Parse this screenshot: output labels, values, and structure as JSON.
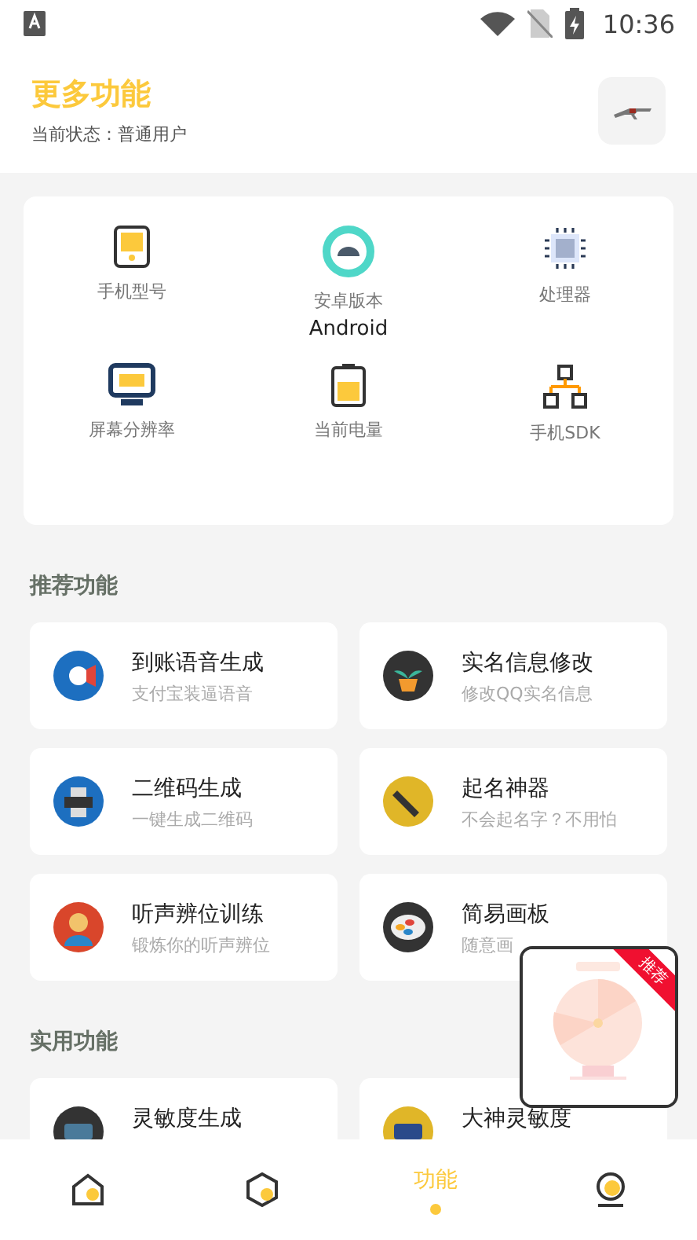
{
  "status_bar": {
    "time": "10:36"
  },
  "header": {
    "title": "更多功能",
    "subtitle": "当前状态：普通用户"
  },
  "device_info": [
    {
      "label": "手机型号"
    },
    {
      "label": "安卓版本",
      "value": "Android"
    },
    {
      "label": "处理器"
    },
    {
      "label": "屏幕分辨率"
    },
    {
      "label": "当前电量"
    },
    {
      "label": "手机SDK"
    }
  ],
  "sections": [
    {
      "title": "推荐功能",
      "cards": [
        {
          "title": "到账语音生成",
          "subtitle": "支付宝装逼语音"
        },
        {
          "title": "实名信息修改",
          "subtitle": "修改QQ实名信息"
        },
        {
          "title": "二维码生成",
          "subtitle": "一键生成二维码"
        },
        {
          "title": "起名神器",
          "subtitle": "不会起名字？不用怕"
        },
        {
          "title": "听声辨位训练",
          "subtitle": "锻炼你的听声辨位"
        },
        {
          "title": "简易画板",
          "subtitle": "随意画"
        }
      ]
    },
    {
      "title": "实用功能",
      "cards": [
        {
          "title": "灵敏度生成"
        },
        {
          "title": "大神灵敏度"
        }
      ]
    }
  ],
  "floating_ad": {
    "badge": "推荐",
    "kind": "picture"
  },
  "nav": [
    {
      "selected": false
    },
    {
      "selected": false
    },
    {
      "label": "功能",
      "selected": true
    },
    {
      "selected": false
    }
  ]
}
